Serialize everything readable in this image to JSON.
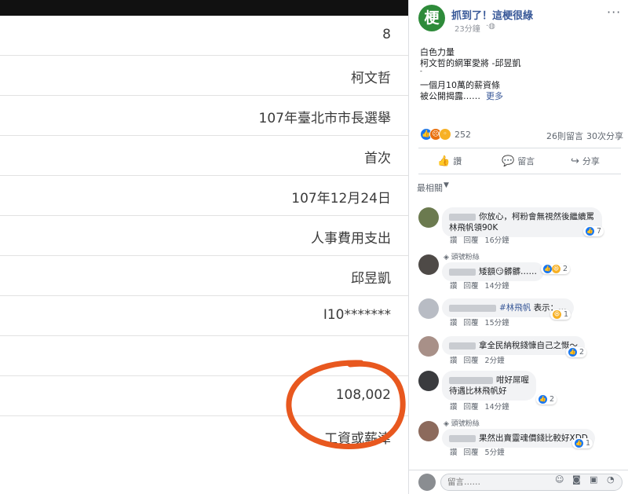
{
  "record": {
    "rows": [
      "8",
      "柯文哲",
      "107年臺北市市長選舉",
      "首次",
      "107年12月24日",
      "人事費用支出",
      "邱昱凱",
      "I10*******",
      "",
      "108,002",
      "工資或薪津"
    ],
    "highlight_color": "#e8581f"
  },
  "post": {
    "avatar_text": "梗",
    "page_name": "抓到了！這梗很綠",
    "time": "23分鐘",
    "globe_icon": "globe-icon",
    "body_lines": [
      "白色力量",
      "柯文哲的網軍愛將 -邱昱凱",
      "-",
      "一個月10萬的薪資條",
      "被公開揭露……"
    ],
    "see_more": "更多",
    "reaction_count": "252",
    "comment_count": "26則留言",
    "share_count": "30次分享",
    "actions": {
      "like": "讚",
      "comment": "留言",
      "share": "分享"
    },
    "sort_label": "最相關",
    "colors": {
      "link": "#385898",
      "like": "#1877f2",
      "angry": "#e9710f",
      "haha": "#f7b125"
    }
  },
  "comments": [
    {
      "text": "你放心，柯粉會無視然後繼續罵林飛帆領90K",
      "actions": [
        "讚",
        "回覆"
      ],
      "time": "16分鐘",
      "reactions": "7"
    },
    {
      "badge": "頭號粉絲",
      "text": "矮額😏髒髒……",
      "actions": [
        "讚",
        "回覆"
      ],
      "time": "14分鐘",
      "reactions": "2"
    },
    {
      "hashtag": "#林飛帆",
      "text": "表示：…",
      "actions": [
        "讚",
        "回覆"
      ],
      "time": "15分鐘",
      "reactions": "1"
    },
    {
      "text": "拿全民納稅錢慷自己之慨～",
      "actions": [
        "讚",
        "回覆"
      ],
      "time": "2分鐘",
      "reactions": "2"
    },
    {
      "text_line1": "咁好屌喔",
      "text_line2": "待遇比林飛帆好",
      "actions": [
        "讚",
        "回覆"
      ],
      "time": "14分鐘",
      "reactions": "2"
    },
    {
      "badge": "頭號粉絲",
      "text": "果然出賣靈魂價錢比較好XDD",
      "actions": [
        "讚",
        "回覆"
      ],
      "time": "5分鐘",
      "reactions": "1"
    }
  ],
  "reply": {
    "placeholder": "留言……"
  }
}
